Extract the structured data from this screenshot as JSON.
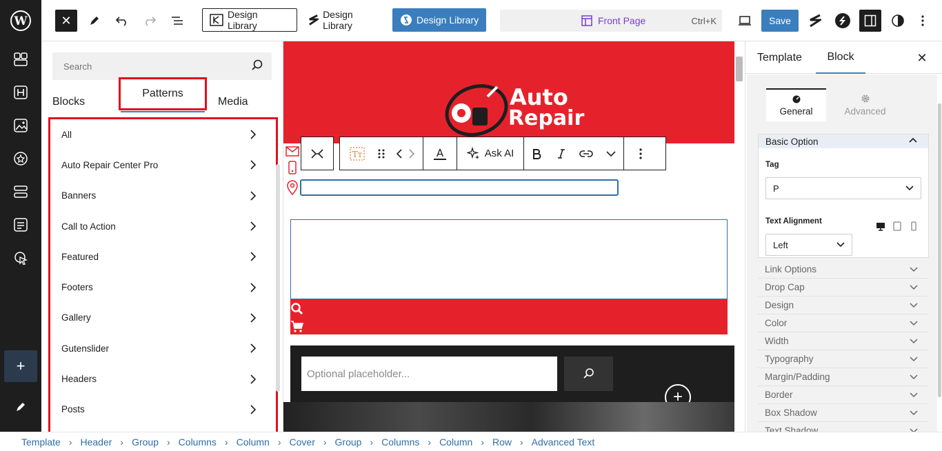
{
  "topbar": {
    "design_library_1": "Design Library",
    "design_library_2": "Design Library",
    "design_library_3": "Design Library",
    "command_page": "Front Page",
    "command_shortcut": "Ctrl+K",
    "save_label": "Save"
  },
  "inserter": {
    "search_placeholder": "Search",
    "tabs": {
      "blocks": "Blocks",
      "patterns": "Patterns",
      "media": "Media"
    },
    "categories": [
      "All",
      "Auto Repair Center Pro",
      "Banners",
      "Call to Action",
      "Featured",
      "Footers",
      "Gallery",
      "Gutenslider",
      "Headers",
      "Posts"
    ]
  },
  "canvas": {
    "logo_line1": "Auto",
    "logo_line2": "Repair",
    "search_placeholder": "Optional placeholder..."
  },
  "block_toolbar": {
    "ask_ai": "Ask AI"
  },
  "settings": {
    "tabs": {
      "template": "Template",
      "block": "Block"
    },
    "sub_tabs": {
      "general": "General",
      "advanced": "Advanced"
    },
    "basic_option": "Basic Option",
    "tag_label": "Tag",
    "tag_value": "P",
    "text_alignment_label": "Text Alignment",
    "text_alignment_value": "Left",
    "accordions": [
      "Link Options",
      "Drop Cap",
      "Design",
      "Color",
      "Width",
      "Typography",
      "Margin/Padding",
      "Border",
      "Box Shadow",
      "Text Shadow"
    ]
  },
  "breadcrumbs": [
    "Template",
    "Header",
    "Group",
    "Columns",
    "Column",
    "Cover",
    "Group",
    "Columns",
    "Column",
    "Row",
    "Advanced Text"
  ],
  "colors": {
    "accent": "#3a7ebd",
    "brand_red": "#e5222c",
    "highlight": "#e00f1f",
    "dark": "#1e1e1e"
  }
}
